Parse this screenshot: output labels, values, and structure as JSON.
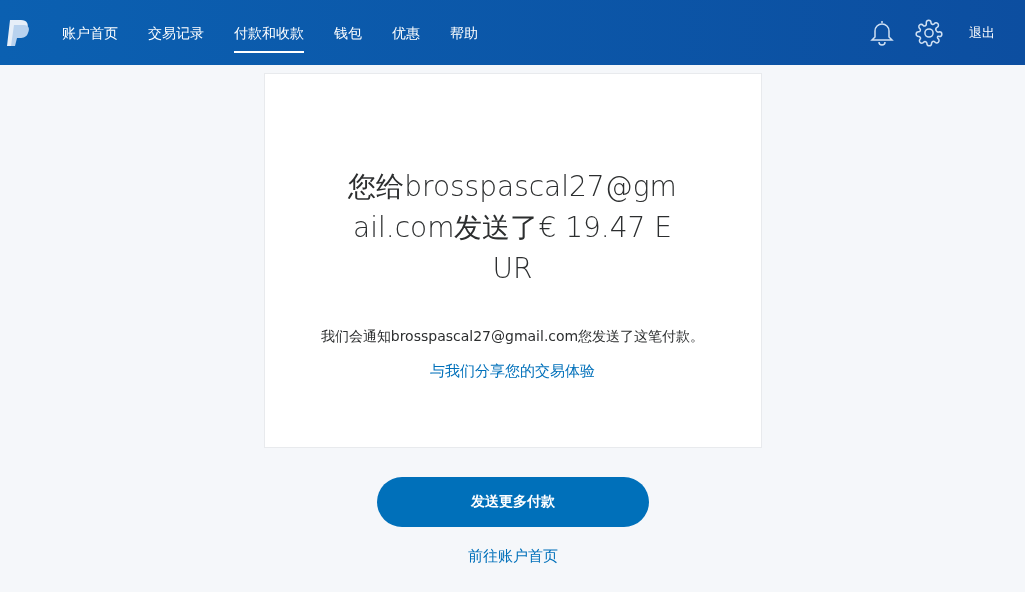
{
  "nav": {
    "items": [
      {
        "label": "账户首页",
        "selected": false
      },
      {
        "label": "交易记录",
        "selected": false
      },
      {
        "label": "付款和收款",
        "selected": true
      },
      {
        "label": "钱包",
        "selected": false
      },
      {
        "label": "优惠",
        "selected": false
      },
      {
        "label": "帮助",
        "selected": false
      }
    ],
    "logout": "退出"
  },
  "card": {
    "heading": "您给brosspascal27@gmail.com发送了€ 19.47 EUR",
    "message": "我们会通知brosspascal27@gmail.com您发送了这笔付款。",
    "feedback_link": "与我们分享您的交易体验"
  },
  "primary_button": "发送更多付款",
  "home_link": "前往账户首页"
}
